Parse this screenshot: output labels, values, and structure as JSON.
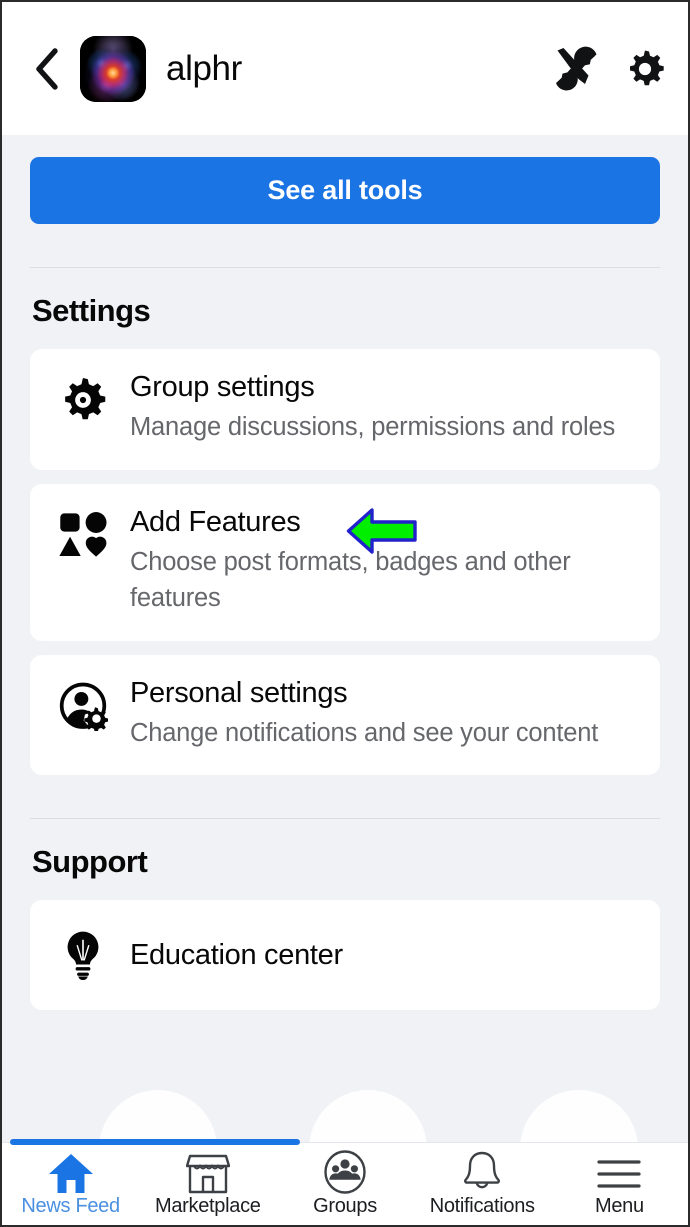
{
  "header": {
    "back_icon": "chevron-left-icon",
    "avatar_alt": "group-avatar",
    "group_name": "alphr",
    "tools_icon": "tools-wrench-screwdriver-icon",
    "settings_icon": "gear-icon"
  },
  "main": {
    "see_all_tools_label": "See all tools",
    "sections": [
      {
        "title": "Settings",
        "items": [
          {
            "icon": "gear-icon",
            "title": "Group settings",
            "subtitle": "Manage discussions, permissions and roles",
            "annotated": true
          },
          {
            "icon": "shapes-features-icon",
            "title": "Add Features",
            "subtitle": "Choose post formats, badges and other features",
            "annotated": false
          },
          {
            "icon": "person-gear-icon",
            "title": "Personal settings",
            "subtitle": "Change notifications and see your content",
            "annotated": false
          }
        ]
      },
      {
        "title": "Support",
        "items": [
          {
            "icon": "lightbulb-icon",
            "title": "Education center",
            "subtitle": "",
            "annotated": false
          }
        ]
      }
    ]
  },
  "annotation": {
    "type": "left-pointing-arrow",
    "fill_color": "#00EE00",
    "stroke_color": "#2222CC",
    "target": "Group settings"
  },
  "bottom_nav": {
    "active_index": 0,
    "items": [
      {
        "icon": "home-icon",
        "label": "News Feed"
      },
      {
        "icon": "storefront-icon",
        "label": "Marketplace"
      },
      {
        "icon": "groups-people-icon",
        "label": "Groups"
      },
      {
        "icon": "bell-icon",
        "label": "Notifications"
      },
      {
        "icon": "hamburger-menu-icon",
        "label": "Menu"
      }
    ]
  },
  "colors": {
    "page_background": "#F0F2F5",
    "card_background": "#FFFFFF",
    "primary_blue": "#1B74E4",
    "active_nav_blue": "#4A90E2",
    "primary_text": "#080809",
    "secondary_text": "#65676B",
    "divider": "#DADDE1"
  }
}
